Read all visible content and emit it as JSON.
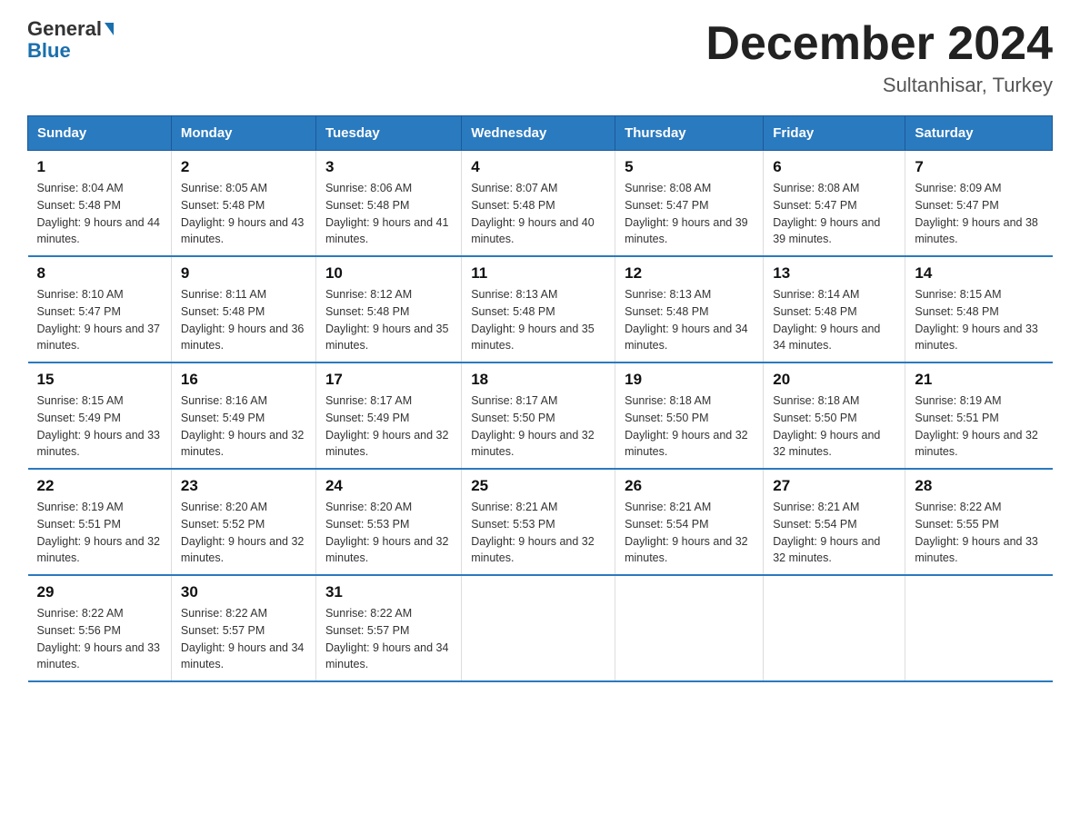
{
  "logo": {
    "line1": "General",
    "triangle": "▶",
    "line2": "Blue"
  },
  "title": "December 2024",
  "location": "Sultanhisar, Turkey",
  "weekdays": [
    "Sunday",
    "Monday",
    "Tuesday",
    "Wednesday",
    "Thursday",
    "Friday",
    "Saturday"
  ],
  "weeks": [
    [
      {
        "day": "1",
        "sunrise": "8:04 AM",
        "sunset": "5:48 PM",
        "daylight": "9 hours and 44 minutes."
      },
      {
        "day": "2",
        "sunrise": "8:05 AM",
        "sunset": "5:48 PM",
        "daylight": "9 hours and 43 minutes."
      },
      {
        "day": "3",
        "sunrise": "8:06 AM",
        "sunset": "5:48 PM",
        "daylight": "9 hours and 41 minutes."
      },
      {
        "day": "4",
        "sunrise": "8:07 AM",
        "sunset": "5:48 PM",
        "daylight": "9 hours and 40 minutes."
      },
      {
        "day": "5",
        "sunrise": "8:08 AM",
        "sunset": "5:47 PM",
        "daylight": "9 hours and 39 minutes."
      },
      {
        "day": "6",
        "sunrise": "8:08 AM",
        "sunset": "5:47 PM",
        "daylight": "9 hours and 39 minutes."
      },
      {
        "day": "7",
        "sunrise": "8:09 AM",
        "sunset": "5:47 PM",
        "daylight": "9 hours and 38 minutes."
      }
    ],
    [
      {
        "day": "8",
        "sunrise": "8:10 AM",
        "sunset": "5:47 PM",
        "daylight": "9 hours and 37 minutes."
      },
      {
        "day": "9",
        "sunrise": "8:11 AM",
        "sunset": "5:48 PM",
        "daylight": "9 hours and 36 minutes."
      },
      {
        "day": "10",
        "sunrise": "8:12 AM",
        "sunset": "5:48 PM",
        "daylight": "9 hours and 35 minutes."
      },
      {
        "day": "11",
        "sunrise": "8:13 AM",
        "sunset": "5:48 PM",
        "daylight": "9 hours and 35 minutes."
      },
      {
        "day": "12",
        "sunrise": "8:13 AM",
        "sunset": "5:48 PM",
        "daylight": "9 hours and 34 minutes."
      },
      {
        "day": "13",
        "sunrise": "8:14 AM",
        "sunset": "5:48 PM",
        "daylight": "9 hours and 34 minutes."
      },
      {
        "day": "14",
        "sunrise": "8:15 AM",
        "sunset": "5:48 PM",
        "daylight": "9 hours and 33 minutes."
      }
    ],
    [
      {
        "day": "15",
        "sunrise": "8:15 AM",
        "sunset": "5:49 PM",
        "daylight": "9 hours and 33 minutes."
      },
      {
        "day": "16",
        "sunrise": "8:16 AM",
        "sunset": "5:49 PM",
        "daylight": "9 hours and 32 minutes."
      },
      {
        "day": "17",
        "sunrise": "8:17 AM",
        "sunset": "5:49 PM",
        "daylight": "9 hours and 32 minutes."
      },
      {
        "day": "18",
        "sunrise": "8:17 AM",
        "sunset": "5:50 PM",
        "daylight": "9 hours and 32 minutes."
      },
      {
        "day": "19",
        "sunrise": "8:18 AM",
        "sunset": "5:50 PM",
        "daylight": "9 hours and 32 minutes."
      },
      {
        "day": "20",
        "sunrise": "8:18 AM",
        "sunset": "5:50 PM",
        "daylight": "9 hours and 32 minutes."
      },
      {
        "day": "21",
        "sunrise": "8:19 AM",
        "sunset": "5:51 PM",
        "daylight": "9 hours and 32 minutes."
      }
    ],
    [
      {
        "day": "22",
        "sunrise": "8:19 AM",
        "sunset": "5:51 PM",
        "daylight": "9 hours and 32 minutes."
      },
      {
        "day": "23",
        "sunrise": "8:20 AM",
        "sunset": "5:52 PM",
        "daylight": "9 hours and 32 minutes."
      },
      {
        "day": "24",
        "sunrise": "8:20 AM",
        "sunset": "5:53 PM",
        "daylight": "9 hours and 32 minutes."
      },
      {
        "day": "25",
        "sunrise": "8:21 AM",
        "sunset": "5:53 PM",
        "daylight": "9 hours and 32 minutes."
      },
      {
        "day": "26",
        "sunrise": "8:21 AM",
        "sunset": "5:54 PM",
        "daylight": "9 hours and 32 minutes."
      },
      {
        "day": "27",
        "sunrise": "8:21 AM",
        "sunset": "5:54 PM",
        "daylight": "9 hours and 32 minutes."
      },
      {
        "day": "28",
        "sunrise": "8:22 AM",
        "sunset": "5:55 PM",
        "daylight": "9 hours and 33 minutes."
      }
    ],
    [
      {
        "day": "29",
        "sunrise": "8:22 AM",
        "sunset": "5:56 PM",
        "daylight": "9 hours and 33 minutes."
      },
      {
        "day": "30",
        "sunrise": "8:22 AM",
        "sunset": "5:57 PM",
        "daylight": "9 hours and 34 minutes."
      },
      {
        "day": "31",
        "sunrise": "8:22 AM",
        "sunset": "5:57 PM",
        "daylight": "9 hours and 34 minutes."
      },
      null,
      null,
      null,
      null
    ]
  ]
}
